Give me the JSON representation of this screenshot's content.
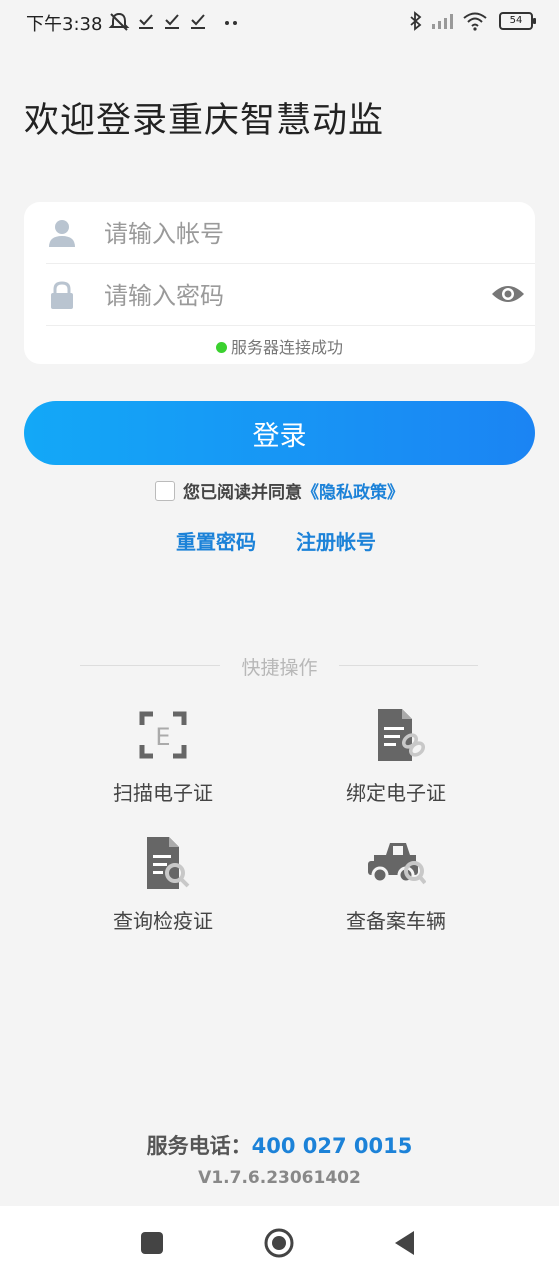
{
  "status_bar": {
    "time": "下午3:38",
    "battery": "54"
  },
  "title": "欢迎登录重庆智慧动监",
  "login_form": {
    "account_placeholder": "请输入帐号",
    "password_placeholder": "请输入密码",
    "connection_status": "服务器连接成功"
  },
  "login_button": "登录",
  "agreement": {
    "text": "您已阅读并同意",
    "policy_link": "《隐私政策》"
  },
  "links": {
    "reset_password": "重置密码",
    "register": "注册帐号"
  },
  "quick_actions": {
    "title": "快捷操作",
    "items": [
      {
        "label": "扫描电子证",
        "icon": "scan-icon"
      },
      {
        "label": "绑定电子证",
        "icon": "document-link-icon"
      },
      {
        "label": "查询检疫证",
        "icon": "document-search-icon"
      },
      {
        "label": "查备案车辆",
        "icon": "vehicle-search-icon"
      }
    ]
  },
  "footer": {
    "phone_label": "服务电话：",
    "phone_number": "400 027 0015",
    "version": "V1.7.6.23061402"
  },
  "colors": {
    "accent": "#1c82d8",
    "button_gradient_start": "#13a8f7",
    "button_gradient_end": "#1b84f3",
    "connected": "#3bd12f"
  }
}
